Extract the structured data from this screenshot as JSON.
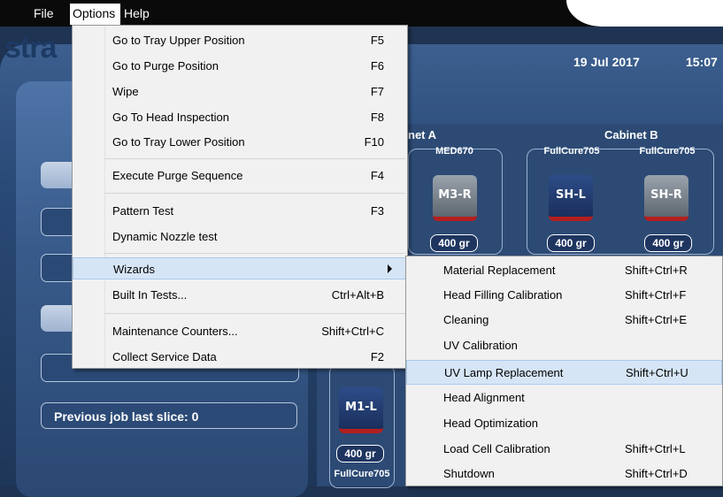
{
  "menubar": {
    "file": "File",
    "options": "Options",
    "help": "Help"
  },
  "app": {
    "logo": "stra",
    "date": "19 Jul 2017",
    "time": "15:07",
    "cabinet_a": "net A",
    "cabinet_b": "Cabinet B",
    "previous_job": "Previous job last slice: 0",
    "cartridges": [
      {
        "material": "MED670",
        "slot": "M3-R",
        "weight": "400 gr"
      },
      {
        "material": "FullCure705",
        "slot": "SH-L",
        "weight": "400 gr"
      },
      {
        "material": "FullCure705",
        "slot": "SH-R",
        "weight": "400 gr"
      },
      {
        "material": "FullCure705",
        "slot": "M1-L",
        "weight": "400 gr"
      }
    ]
  },
  "options_menu": {
    "items": [
      {
        "label": "Go to Tray Upper Position",
        "shortcut": "F5"
      },
      {
        "label": "Go to Purge Position",
        "shortcut": "F6"
      },
      {
        "label": "Wipe",
        "shortcut": "F7"
      },
      {
        "label": "Go To Head Inspection",
        "shortcut": "F8"
      },
      {
        "label": "Go to Tray Lower Position",
        "shortcut": "F10"
      },
      {
        "label": "Execute Purge Sequence",
        "shortcut": "F4"
      },
      {
        "label": "Pattern Test",
        "shortcut": "F3"
      },
      {
        "label": "Dynamic Nozzle test",
        "shortcut": ""
      },
      {
        "label": "Wizards",
        "shortcut": ""
      },
      {
        "label": "Built In Tests...",
        "shortcut": "Ctrl+Alt+B"
      },
      {
        "label": "Maintenance Counters...",
        "shortcut": "Shift+Ctrl+C"
      },
      {
        "label": "Collect Service Data",
        "shortcut": "F2"
      }
    ]
  },
  "wizards_menu": {
    "items": [
      {
        "label": "Material Replacement",
        "shortcut": "Shift+Ctrl+R"
      },
      {
        "label": "Head Filling Calibration",
        "shortcut": "Shift+Ctrl+F"
      },
      {
        "label": "Cleaning",
        "shortcut": "Shift+Ctrl+E"
      },
      {
        "label": "UV Calibration",
        "shortcut": ""
      },
      {
        "label": "UV Lamp Replacement",
        "shortcut": "Shift+Ctrl+U"
      },
      {
        "label": "Head Alignment",
        "shortcut": ""
      },
      {
        "label": "Head Optimization",
        "shortcut": ""
      },
      {
        "label": "Load Cell Calibration",
        "shortcut": "Shift+Ctrl+L"
      },
      {
        "label": "Shutdown",
        "shortcut": "Shift+Ctrl+D"
      }
    ]
  },
  "colors": {
    "menu_bg": "#f1f1f1",
    "highlight": "#d6e5f6",
    "app_blue": "#2c4a74",
    "cartridge_red": "#b41e1e"
  }
}
